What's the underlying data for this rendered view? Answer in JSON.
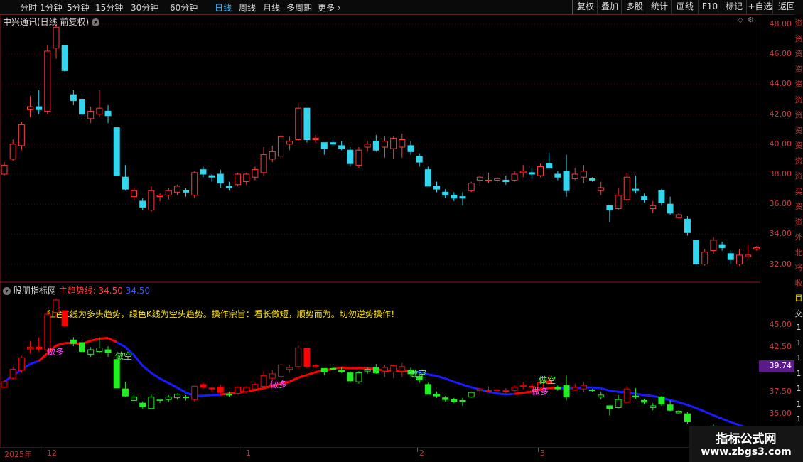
{
  "toolbar": {
    "periods": [
      "分时",
      "1分钟",
      "5分钟",
      "15分钟",
      "30分钟",
      "60分钟",
      "日线",
      "周线",
      "月线",
      "多周期",
      "更多"
    ],
    "active_period": "日线",
    "buttons": [
      "复权",
      "叠加",
      "多股",
      "统计",
      "画线",
      "F10",
      "标记",
      "+自选",
      "返回"
    ]
  },
  "main_panel": {
    "title": "中兴通讯(日线 前复权)",
    "y_ticks": [
      "48.00",
      "46.00",
      "44.00",
      "42.00",
      "40.00",
      "38.00",
      "36.00",
      "34.00",
      "32.00"
    ]
  },
  "indicator_panel": {
    "name": "股朋指标网",
    "series_label": "主趋势线: 34.50",
    "series_value2": "34.50",
    "note": "红色K线为多头趋势，绿色K线为空头趋势。操作宗旨：看长做短，顺势而为。切勿逆势操作！",
    "y_ticks": [
      "45.00",
      "42.50",
      "37.50",
      "35.00"
    ],
    "price_tag": "39.74",
    "signals": [
      {
        "text": "做多",
        "color": "#ff55ff"
      },
      {
        "text": "做空",
        "color": "#55ff55"
      },
      {
        "text": "做多",
        "color": "#ff55ff"
      },
      {
        "text": "做空",
        "color": "#55ff55"
      },
      {
        "text": "做空",
        "color": "#55ff55"
      },
      {
        "text": "做多",
        "color": "#ff55ff"
      }
    ]
  },
  "date_axis": [
    "2025年",
    "12",
    "1",
    "2",
    "3"
  ],
  "right_strip": [
    "资",
    "资",
    "资",
    "资",
    "资",
    "资",
    "资",
    "资",
    "资",
    "资",
    "资",
    "买",
    "资",
    "资",
    "外",
    "北",
    "将",
    "收",
    "目",
    "交",
    "1",
    "1",
    "1",
    "1",
    "1",
    "1",
    "1"
  ],
  "watermark": {
    "title": "指标公式网",
    "url": "www.zbgs3.com"
  },
  "colors": {
    "up": "#ff3c3c",
    "down": "#33d6ee",
    "trend_up": "#ff0000",
    "trend_down": "#1a1aff",
    "ind_up": "#ff0000",
    "ind_down": "#22ee22"
  },
  "chart_data": {
    "type": "candlestick",
    "title": "中兴通讯(日线 前复权)",
    "ylim": [
      31.5,
      48.5
    ],
    "ohlc": [
      [
        38.0,
        38.8,
        37.9,
        38.6
      ],
      [
        39.0,
        40.3,
        38.9,
        40.0
      ],
      [
        39.9,
        41.5,
        39.6,
        41.3
      ],
      [
        42.3,
        43.2,
        41.8,
        42.5
      ],
      [
        42.5,
        43.6,
        42.0,
        42.3
      ],
      [
        42.2,
        46.6,
        42.0,
        46.2
      ],
      [
        46.4,
        48.0,
        45.7,
        47.8
      ],
      [
        46.6,
        46.6,
        44.8,
        44.9
      ],
      [
        43.3,
        43.6,
        42.6,
        42.9
      ],
      [
        43.0,
        43.4,
        41.9,
        42.0
      ],
      [
        41.7,
        42.5,
        41.4,
        42.2
      ],
      [
        42.0,
        43.6,
        41.8,
        42.4
      ],
      [
        42.2,
        42.6,
        41.4,
        41.9
      ],
      [
        41.1,
        41.1,
        37.9,
        37.9
      ],
      [
        37.8,
        38.6,
        36.9,
        37.0
      ],
      [
        36.5,
        37.1,
        36.3,
        36.9
      ],
      [
        36.2,
        36.4,
        35.6,
        35.8
      ],
      [
        35.6,
        37.2,
        35.5,
        36.9
      ],
      [
        36.5,
        36.7,
        36.2,
        36.6
      ],
      [
        36.6,
        37.1,
        36.3,
        36.9
      ],
      [
        36.8,
        37.3,
        36.6,
        37.2
      ],
      [
        36.9,
        37.1,
        36.5,
        36.8
      ],
      [
        36.6,
        38.2,
        36.4,
        38.1
      ],
      [
        38.3,
        38.5,
        37.8,
        38.0
      ],
      [
        37.9,
        38.0,
        37.5,
        37.8
      ],
      [
        38.0,
        38.3,
        37.1,
        37.4
      ],
      [
        37.2,
        37.5,
        36.9,
        37.1
      ],
      [
        37.3,
        38.1,
        37.2,
        38.0
      ],
      [
        37.5,
        38.1,
        37.3,
        38.0
      ],
      [
        37.8,
        38.5,
        37.6,
        38.3
      ],
      [
        38.1,
        39.8,
        37.9,
        39.3
      ],
      [
        39.0,
        39.9,
        38.8,
        39.5
      ],
      [
        39.2,
        40.6,
        39.0,
        40.5
      ],
      [
        40.0,
        40.5,
        39.6,
        40.2
      ],
      [
        40.3,
        42.7,
        40.2,
        42.4
      ],
      [
        42.4,
        42.4,
        40.1,
        40.3
      ],
      [
        40.3,
        40.6,
        40.1,
        40.4
      ],
      [
        40.1,
        40.1,
        39.3,
        39.7
      ],
      [
        40.1,
        40.3,
        39.9,
        40.0
      ],
      [
        39.9,
        40.2,
        39.6,
        39.7
      ],
      [
        39.6,
        39.8,
        38.5,
        38.7
      ],
      [
        38.6,
        39.8,
        38.4,
        39.6
      ],
      [
        39.8,
        40.2,
        39.5,
        40.0
      ],
      [
        40.2,
        40.6,
        39.5,
        39.6
      ],
      [
        39.8,
        40.5,
        39.1,
        40.2
      ],
      [
        39.7,
        40.5,
        39.0,
        40.4
      ],
      [
        39.8,
        40.7,
        39.1,
        40.3
      ],
      [
        39.9,
        40.2,
        39.3,
        39.5
      ],
      [
        39.2,
        39.4,
        38.5,
        38.8
      ],
      [
        38.3,
        38.5,
        37.2,
        37.2
      ],
      [
        37.2,
        37.5,
        36.8,
        37.0
      ],
      [
        36.8,
        37.0,
        36.4,
        36.6
      ],
      [
        36.6,
        36.8,
        36.2,
        36.4
      ],
      [
        36.5,
        36.8,
        35.9,
        36.4
      ],
      [
        36.9,
        37.5,
        36.8,
        37.4
      ],
      [
        37.6,
        37.9,
        37.2,
        37.8
      ],
      [
        37.6,
        38.1,
        37.4,
        37.6
      ],
      [
        37.6,
        37.8,
        37.4,
        37.7
      ],
      [
        37.6,
        37.9,
        37.3,
        37.5
      ],
      [
        37.6,
        38.2,
        37.5,
        38.0
      ],
      [
        38.1,
        38.6,
        37.8,
        38.2
      ],
      [
        38.1,
        38.4,
        37.7,
        38.0
      ],
      [
        37.9,
        38.7,
        37.8,
        38.5
      ],
      [
        38.7,
        39.4,
        38.4,
        38.4
      ],
      [
        38.0,
        38.2,
        37.6,
        37.8
      ],
      [
        38.2,
        39.3,
        36.5,
        36.9
      ],
      [
        37.7,
        38.4,
        37.6,
        38.0
      ],
      [
        37.8,
        38.6,
        37.4,
        38.2
      ],
      [
        37.7,
        37.8,
        37.5,
        37.6
      ],
      [
        36.9,
        37.5,
        36.6,
        37.1
      ],
      [
        35.9,
        35.9,
        34.8,
        35.6
      ],
      [
        35.7,
        37.1,
        35.6,
        36.6
      ],
      [
        36.3,
        38.1,
        36.2,
        37.8
      ],
      [
        37.0,
        37.9,
        36.7,
        36.9
      ],
      [
        36.5,
        36.7,
        36.1,
        36.3
      ],
      [
        35.7,
        36.2,
        35.4,
        35.9
      ],
      [
        36.9,
        37.0,
        35.9,
        36.1
      ],
      [
        36.0,
        36.5,
        35.3,
        35.4
      ],
      [
        35.1,
        35.4,
        35.0,
        35.3
      ],
      [
        35.0,
        35.2,
        33.9,
        34.1
      ],
      [
        33.6,
        33.6,
        31.9,
        32.0
      ],
      [
        32.0,
        33.0,
        31.9,
        32.8
      ],
      [
        32.9,
        33.8,
        32.7,
        33.6
      ],
      [
        33.3,
        33.5,
        32.9,
        33.1
      ],
      [
        32.7,
        32.9,
        32.0,
        32.3
      ],
      [
        32.0,
        33.0,
        31.9,
        32.6
      ],
      [
        32.5,
        33.3,
        32.4,
        32.6
      ],
      [
        33.0,
        33.2,
        32.9,
        33.1
      ]
    ],
    "trend_line_last": 34.5
  }
}
